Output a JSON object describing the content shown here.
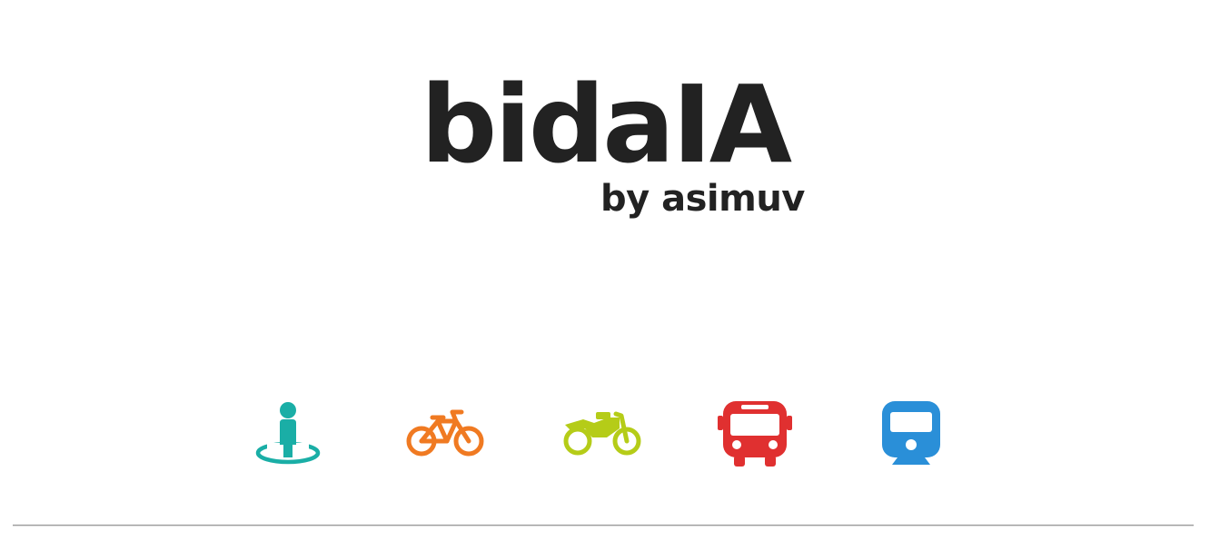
{
  "header": {
    "title": "bidaIA",
    "subtitle": "by asimuv"
  },
  "transport_modes": [
    {
      "name": "walk",
      "icon": "pedestrian-icon",
      "color": "#1aaea6"
    },
    {
      "name": "bicycle",
      "icon": "bicycle-icon",
      "color": "#f07a22"
    },
    {
      "name": "motorcycle",
      "icon": "motorcycle-icon",
      "color": "#b5cc18"
    },
    {
      "name": "bus",
      "icon": "bus-icon",
      "color": "#e03030"
    },
    {
      "name": "train",
      "icon": "train-icon",
      "color": "#2a8fd8"
    }
  ]
}
